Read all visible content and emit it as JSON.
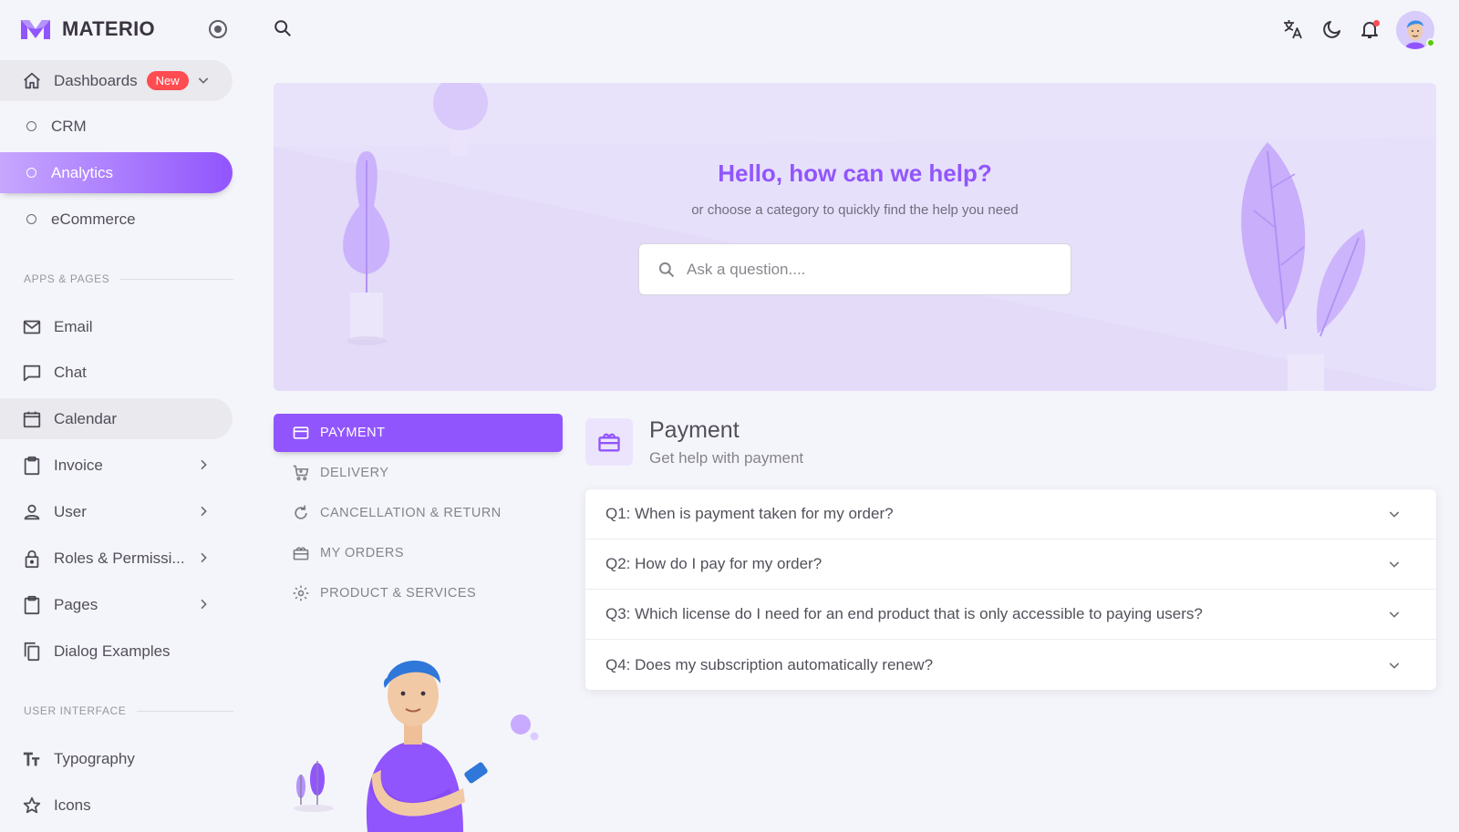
{
  "brand": {
    "name": "MATERIO"
  },
  "sidebar": {
    "dashboards": {
      "label": "Dashboards",
      "badge": "New"
    },
    "dashboard_items": [
      {
        "label": "CRM"
      },
      {
        "label": "Analytics"
      },
      {
        "label": "eCommerce"
      }
    ],
    "apps_section": "APPS & PAGES",
    "apps_items": [
      {
        "label": "Email",
        "icon": "email-icon"
      },
      {
        "label": "Chat",
        "icon": "chat-icon"
      },
      {
        "label": "Calendar",
        "icon": "calendar-icon"
      },
      {
        "label": "Invoice",
        "icon": "invoice-icon"
      },
      {
        "label": "User",
        "icon": "user-icon"
      },
      {
        "label": "Roles & Permissi...",
        "icon": "lock-icon"
      },
      {
        "label": "Pages",
        "icon": "pages-icon"
      },
      {
        "label": "Dialog Examples",
        "icon": "copy-icon"
      }
    ],
    "ui_section": "USER INTERFACE",
    "ui_items": [
      {
        "label": "Typography",
        "icon": "typography-icon"
      },
      {
        "label": "Icons",
        "icon": "star-icon"
      }
    ]
  },
  "hero": {
    "title": "Hello, how can we help?",
    "subtitle": "or choose a category to quickly find the help you need",
    "search_placeholder": "Ask a question...."
  },
  "categories": [
    {
      "label": "PAYMENT",
      "icon": "credit-card-icon",
      "active": true
    },
    {
      "label": "DELIVERY",
      "icon": "cart-icon",
      "active": false
    },
    {
      "label": "CANCELLATION & RETURN",
      "icon": "refresh-icon",
      "active": false
    },
    {
      "label": "MY ORDERS",
      "icon": "archive-icon",
      "active": false
    },
    {
      "label": "PRODUCT & SERVICES",
      "icon": "settings-icon",
      "active": false
    }
  ],
  "faq": {
    "title": "Payment",
    "subtitle": "Get help with payment",
    "questions": [
      "Q1: When is payment taken for my order?",
      "Q2: How do I pay for my order?",
      "Q3: Which license do I need for an end product that is only accessible to paying users?",
      "Q4: Does my subscription automatically renew?"
    ]
  },
  "colors": {
    "primary": "#9155fd",
    "badge": "#ff4c51",
    "online": "#56ca00",
    "hero_bg": "#e7e0fb"
  }
}
